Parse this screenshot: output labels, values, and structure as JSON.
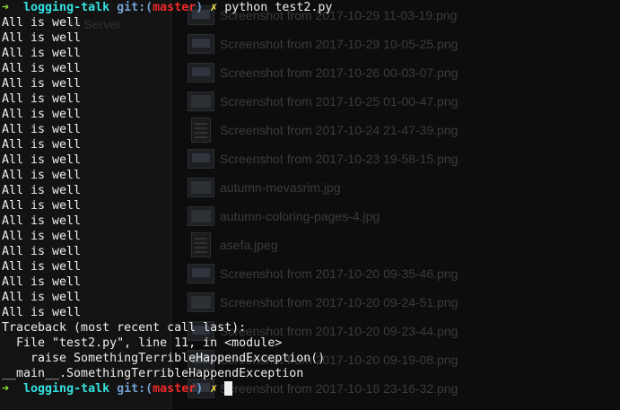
{
  "file_manager": {
    "connect_label": "to Server",
    "files": [
      {
        "name": "Screenshot from 2017-10-29 11-03-19.png",
        "thumb": "screenshot"
      },
      {
        "name": "Screenshot from 2017-10-29 10-05-25.png",
        "thumb": "screenshot"
      },
      {
        "name": "Screenshot from 2017-10-26 00-03-07.png",
        "thumb": "screenshot"
      },
      {
        "name": "Screenshot from 2017-10-25 01-00-47.png",
        "thumb": "image"
      },
      {
        "name": "Screenshot from 2017-10-24 21-47-39.png",
        "thumb": "document"
      },
      {
        "name": "Screenshot from 2017-10-23 19-58-15.png",
        "thumb": "screenshot"
      },
      {
        "name": "autumn-mevasrim.jpg",
        "thumb": "image"
      },
      {
        "name": "autumn-coloring-pages-4.jpg",
        "thumb": "image"
      },
      {
        "name": "asefa.jpeg",
        "thumb": "document"
      },
      {
        "name": "Screenshot from 2017-10-20 09-35-46.png",
        "thumb": "screenshot"
      },
      {
        "name": "Screenshot from 2017-10-20 09-24-51.png",
        "thumb": "image"
      },
      {
        "name": "Screenshot from 2017-10-20 09-23-44.png",
        "thumb": "screenshot"
      },
      {
        "name": "Screenshot from 2017-10-20 09-19-08.png",
        "thumb": "screenshot"
      },
      {
        "name": "Screenshot from 2017-10-18 23-16-32.png",
        "thumb": "screenshot"
      }
    ]
  },
  "terminal": {
    "prompt": {
      "arrow": "➜",
      "directory": "logging-talk",
      "git_label": "git:",
      "open_paren": "(",
      "branch": "master",
      "close_paren": ")",
      "dirty_marker": "✗"
    },
    "command": "python test2.py",
    "output_lines": [
      "All is well",
      "All is well",
      "All is well",
      "All is well",
      "All is well",
      "All is well",
      "All is well",
      "All is well",
      "All is well",
      "All is well",
      "All is well",
      "All is well",
      "All is well",
      "All is well",
      "All is well",
      "All is well",
      "All is well",
      "All is well",
      "All is well",
      "All is well"
    ],
    "traceback_lines": [
      "Traceback (most recent call last):",
      "  File \"test2.py\", line 11, in <module>",
      "    raise SomethingTerribleHappendException()",
      "__main__.SomethingTerribleHappendException"
    ]
  },
  "colors": {
    "prompt_arrow": "#8ae234",
    "directory": "#34e2e2",
    "git_label": "#729fcf",
    "branch": "#ef2929",
    "dirty_marker": "#fce94f",
    "text": "#eeeeec"
  }
}
